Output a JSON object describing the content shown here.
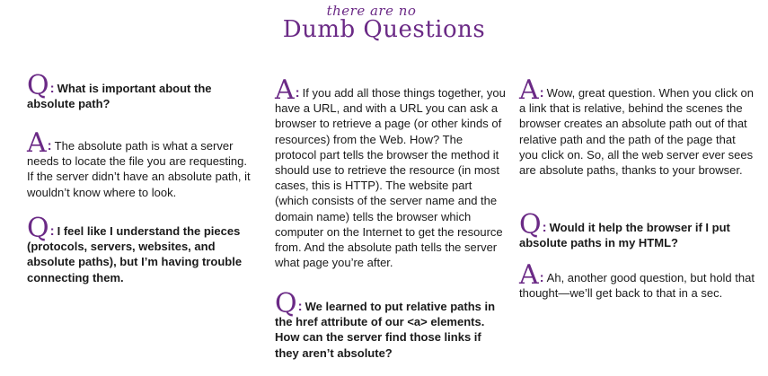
{
  "header": {
    "line1": "there are no",
    "line2": "Dumb Questions"
  },
  "marks": {
    "q": "Q",
    "a": "A",
    "colon": ":"
  },
  "col1": {
    "q1": "What is important about the absolute path?",
    "a1": "The absolute path is what a server needs to locate the file you are requesting. If the server didn’t have an absolute path, it wouldn’t know where to look.",
    "q2": "I feel like I understand the pieces (protocols, servers, websites, and absolute paths), but I’m having trouble connecting them."
  },
  "col2": {
    "a1": "If you add all those things together, you have a URL, and with a URL you can ask a browser to retrieve a page (or other kinds of resources) from the Web. How? The protocol part tells the browser the method it should use to retrieve the resource (in most cases, this is HTTP). The website part (which consists of the server name and the domain name) tells the browser which computer on the Internet to get the resource from. And the absolute path tells the server what page you’re after.",
    "q1": "We learned to put relative paths in the href attribute of our <a> elements. How can the server find those links if they aren’t absolute?"
  },
  "col3": {
    "a1": "Wow, great question. When you click on a link that is relative, behind the scenes the browser creates an absolute path out of that relative path and the path of the page that you click on. So, all the web server ever sees are absolute paths, thanks to your browser.",
    "q1": "Would it help the browser if I put absolute paths in my HTML?",
    "a2": "Ah, another good question, but hold that thought—we’ll get back to that in a sec."
  }
}
